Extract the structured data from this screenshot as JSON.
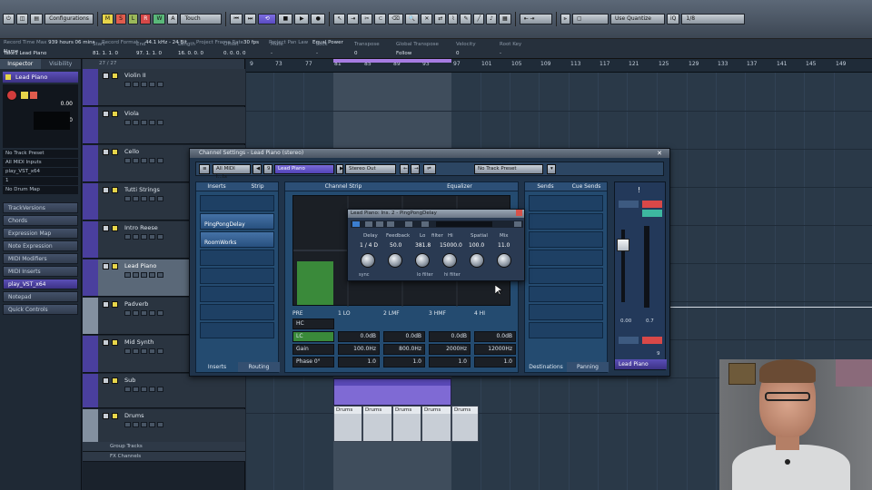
{
  "toolbar": {
    "configurations_label": "Configurations",
    "mode_buttons": [
      "M",
      "S",
      "L",
      "R",
      "W",
      "A"
    ],
    "automation_mode": "Touch",
    "quantize_label": "Use Quantize",
    "grid_value": "1/8"
  },
  "infoline": {
    "record_time_max_label": "Record Time Max",
    "record_time_max_value": "939 hours 06 mins",
    "record_format_label": "Record Format",
    "record_format_value": "44.1 kHz - 24 Bit",
    "frame_rate_label": "Project Frame Rate",
    "frame_rate_value": "30 fps",
    "pan_law_label": "Project Pan Law",
    "pan_law_value": "Equal Power",
    "name_label": "Name",
    "name_value": "Take1 Lead Piano",
    "start_label": "Start",
    "start_value": "81. 1. 1. 0",
    "end_label": "End",
    "end_value": "97. 1. 1. 0",
    "length_label": "Length",
    "length_value": "16. 0. 0. 0",
    "offset_label": "Offset",
    "offset_value": "0. 0. 0. 0",
    "mute_label": "Mute",
    "mute_value": "-",
    "lock_label": "Lock",
    "lock_value": "-",
    "transpose_label": "Transpose",
    "transpose_value": "0",
    "global_transpose_label": "Global Transpose",
    "global_transpose_value": "Follow",
    "velocity_label": "Velocity",
    "velocity_value": "0",
    "root_key_label": "Root Key",
    "root_key_value": "-"
  },
  "inspector": {
    "tabs": [
      "Inspector",
      "Visibility"
    ],
    "track_name": "Lead Piano",
    "values": [
      "0.00",
      "0.00"
    ],
    "list": [
      "No Track Preset",
      "All MIDI Inputs",
      "play_VST_x64",
      "1",
      "No Drum Map"
    ],
    "sections": [
      "TrackVersions",
      "Chords",
      "Expression Map",
      "Note Expression",
      "MIDI Modifiers",
      "MIDI Inserts"
    ],
    "vst_section": "play_VST_x64",
    "sections_after": [
      "Notepad",
      "Quick Controls"
    ]
  },
  "tracklist": {
    "header": "27 / 27",
    "tracks": [
      "Violin II",
      "Viola",
      "Cello",
      "Tutti Strings",
      "Intro Reese",
      "Lead Piano",
      "Padverb",
      "Mid Synth",
      "Sub",
      "Drums"
    ],
    "folders": [
      "Group Tracks",
      "FX Channels"
    ]
  },
  "ruler": {
    "ticks": [
      "9",
      "73",
      "77",
      "81",
      "85",
      "89",
      "93",
      "97",
      "101",
      "105",
      "109",
      "113",
      "117",
      "121",
      "125",
      "129",
      "133",
      "137",
      "141",
      "145",
      "149"
    ]
  },
  "arrange": {
    "drums_parts": [
      "Drums",
      "Drums",
      "Drums",
      "Drums",
      "Drums"
    ]
  },
  "channel_settings": {
    "title": "Channel Settings - Lead Piano (stereo)",
    "input": "All MIDI I...ts",
    "input_index": "9",
    "channel_name": "Lead Piano",
    "output": "Stereo Out",
    "preset": "No Track Preset",
    "inserts_tab": "Inserts",
    "strip_tab": "Strip",
    "channel_strip_tab": "Channel Strip",
    "equalizer_tab": "Equalizer",
    "sends_tab": "Sends",
    "cue_sends_tab": "Cue Sends",
    "insert_slots": [
      "PingPongDelay",
      "RoomWorks"
    ],
    "bottom_tabs_left": [
      "Inserts",
      "Routing"
    ],
    "bottom_tabs_right": [
      "Destinations",
      "Panning"
    ],
    "eq_bands": [
      {
        "num": "1",
        "name": "LO",
        "gain": "0.0dB",
        "freq": "100.0Hz",
        "q": "1.0"
      },
      {
        "num": "2",
        "name": "LMF",
        "gain": "0.0dB",
        "freq": "800.0Hz",
        "q": "1.0"
      },
      {
        "num": "3",
        "name": "HMF",
        "gain": "0.0dB",
        "freq": "2000Hz",
        "q": "1.0"
      },
      {
        "num": "4",
        "name": "HI",
        "gain": "0.0dB",
        "freq": "12000Hz",
        "q": "1.0"
      }
    ],
    "pre_label": "PRE",
    "hc_label": "HC",
    "lc_label": "LC",
    "gain_label": "Gain",
    "phase_label": "Phase 0°",
    "eq_db_ticks": [
      "+24",
      "+12",
      "+6",
      "0",
      "-6",
      "-12",
      "-24"
    ],
    "eq_freq_ticks": [
      "20",
      "50",
      "100",
      "200",
      "500",
      "1k",
      "2k",
      "5k",
      "10k",
      "20k"
    ]
  },
  "pingpong": {
    "title": "Lead Piano: Ins. 2 - PingPongDelay",
    "params": [
      {
        "label": "Delay",
        "value": "1 / 4 D"
      },
      {
        "label": "Feedback",
        "value": "50.0"
      },
      {
        "label": "Lo",
        "value": "381.8"
      },
      {
        "label": "filter",
        "value": ""
      },
      {
        "label": "Hi",
        "value": "15000.0"
      },
      {
        "label": "Spatial",
        "value": "100.0"
      },
      {
        "label": "Mix",
        "value": "11.0"
      }
    ],
    "switches": [
      "sync",
      "lo filter",
      "hi filter"
    ]
  },
  "strip": {
    "name": "Lead Piano",
    "volume": "0.00",
    "pan": "0.7",
    "channel_num": "9",
    "fader_scale": [
      "6",
      "0",
      "-6",
      "-12",
      "-18",
      "-24",
      "-30",
      "-36",
      "-42",
      "-48",
      "-54",
      "-60"
    ]
  }
}
